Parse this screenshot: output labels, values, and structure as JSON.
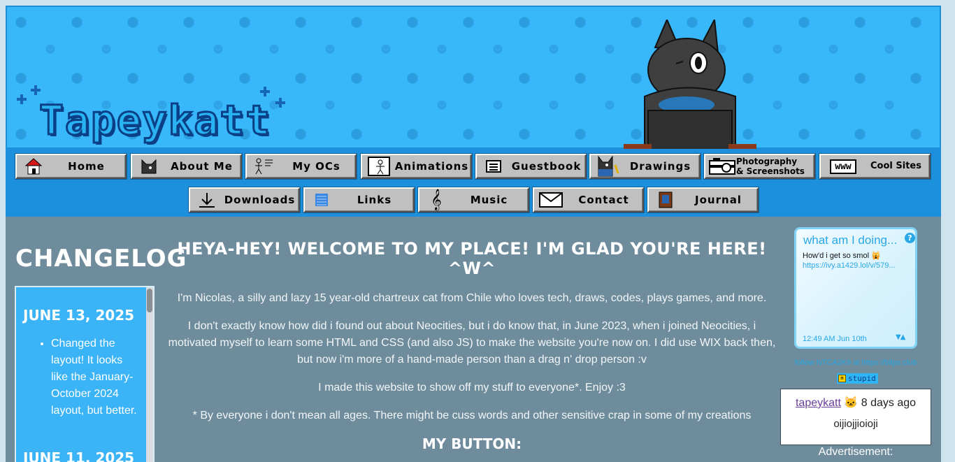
{
  "site": {
    "logo_text": "Tapeykatt"
  },
  "nav": {
    "row1": [
      {
        "label": "Home",
        "icon": "house-icon"
      },
      {
        "label": "About Me",
        "icon": "cat-face-icon"
      },
      {
        "label": "My OCs",
        "icon": "stick-figure-icon"
      },
      {
        "label": "Animations",
        "icon": "animation-frame-icon"
      },
      {
        "label": "Guestbook",
        "icon": "notebook-icon"
      },
      {
        "label": "Drawings",
        "icon": "cat-drawing-icon"
      },
      {
        "label": "Photography\n& Screenshots",
        "icon": "camera-icon"
      },
      {
        "label": "Cool Sites",
        "icon": "www-icon",
        "icon_text": "www"
      }
    ],
    "row2": [
      {
        "label": "Downloads",
        "icon": "download-arrow-icon"
      },
      {
        "label": "Links",
        "icon": "link-list-icon"
      },
      {
        "label": "Music",
        "icon": "treble-clef-icon"
      },
      {
        "label": "Contact",
        "icon": "envelope-icon"
      },
      {
        "label": "Journal",
        "icon": "journal-book-icon"
      }
    ]
  },
  "changelog": {
    "title": "CHANGELOG",
    "entries": [
      {
        "date": "JUNE 13, 2025",
        "items": [
          "Changed the layout! It looks like the January-October 2024 layout, but better."
        ]
      },
      {
        "date": "JUNE 11, 2025",
        "items": []
      }
    ]
  },
  "main": {
    "welcome": "HEYA-HEY! WELCOME TO MY PLACE! I'M GLAD YOU'RE HERE! ^W^",
    "paragraphs": [
      "I'm Nicolas, a silly and lazy 15 year-old chartreux cat from Chile who loves tech, draws, codes, plays games, and more.",
      "I don't exactly know how did i found out about Neocities, but i do know that, in June 2023, when i joined Neocities, i motivated myself to learn some HTML and CSS (and also JS) to make the website you're now on. I did use WIX back then, but now i'm more of a hand-made person than a drag n' drop person :v",
      "I made this website to show off my stuff to everyone*. Enjoy :3",
      "* By everyone i don't mean all ages. There might be cuss words and other sensitive crap in some of my creations"
    ],
    "my_button_heading": "MY BUTTON:"
  },
  "status": {
    "title": "what am I doing...",
    "help": "?",
    "text": "How'd i get so smol 🙀",
    "link": "https://ivy.a1429.lol/v/579...",
    "time": "12:49 AM Jun 10th",
    "arrows": "▼▲",
    "follow": "follow NTCA2K9 at https://blips.club"
  },
  "badge": {
    "icon_text": "m",
    "label": "stupid"
  },
  "comment": {
    "user": "tapeykatt",
    "emoji": "🐱",
    "time": "8 days ago",
    "body": "oijiojjioioji"
  },
  "ad": {
    "label": "Advertisement:"
  },
  "colors": {
    "banner": "#38b7fb",
    "navbar": "#1c90dd",
    "content_bg": "#6e8c9c",
    "changelog_box": "#3bb3f7",
    "button_face": "#c0c0c0"
  }
}
